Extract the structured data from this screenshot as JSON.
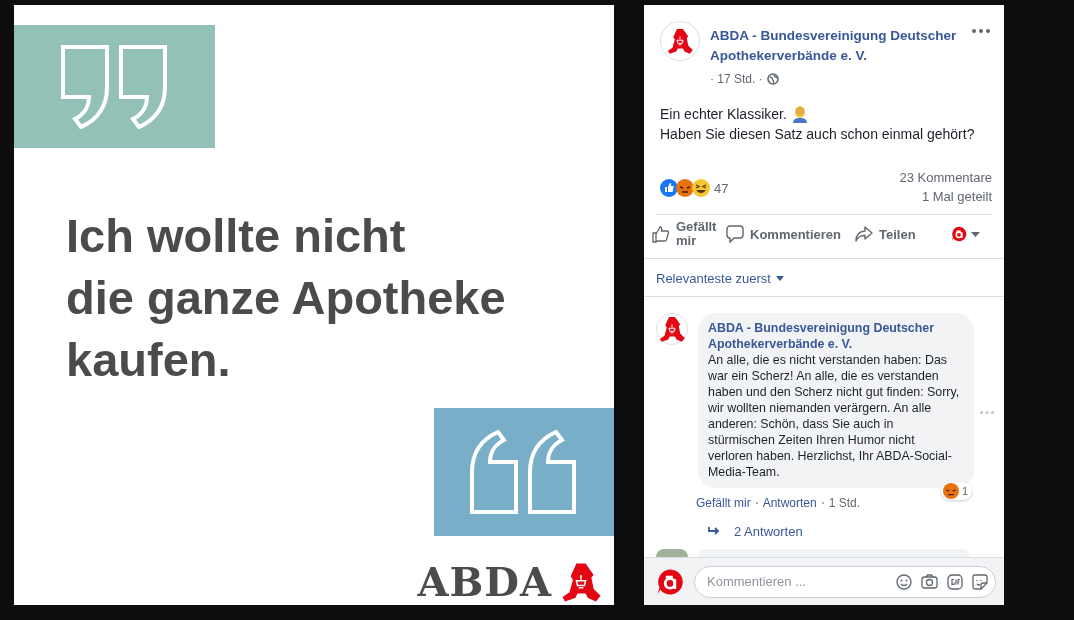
{
  "post_image": {
    "quote_lines": [
      "Ich wollte nicht",
      "die ganze Apotheke",
      "kaufen."
    ],
    "logo_text": "ABDA"
  },
  "post": {
    "author": "ABDA - Bundesvereinigung Deutscher Apothekerverbände e. V.",
    "time": "· 17 Std. ·",
    "text_lines": [
      "Ein echter Klassiker.",
      "Haben Sie diesen Satz auch schon einmal gehört?"
    ],
    "reaction_count": "47",
    "comments_count": "23 Kommentare",
    "shares_count": "1 Mal geteilt",
    "actions": [
      {
        "kind": "like",
        "label": "Gefällt mir"
      },
      {
        "kind": "comment",
        "label": "Kommentieren"
      },
      {
        "kind": "share",
        "label": "Teilen"
      }
    ]
  },
  "comments": {
    "sort": "Relevanteste zuerst",
    "items": [
      {
        "author": "ABDA - Bundesvereinigung Deutscher Apothekerverbände e. V.",
        "text": "An alle, die es nicht verstanden haben: Das war ein Scherz! An alle, die es verstanden haben und den Scherz nicht gut finden: Sorry, wir wollten niemanden verärgern. An alle anderen: Schön, dass Sie auch in stürmischen Zeiten Ihren Humor nicht verloren haben. Herzlichst, Ihr ABDA-Social-Media-Team.",
        "reaction_count": "1",
        "actions": [
          "Gefällt mir",
          "Antworten"
        ],
        "time": "1 Std.",
        "replies": "2 Antworten"
      }
    ]
  },
  "composer": {
    "placeholder": "Kommentieren ..."
  }
}
